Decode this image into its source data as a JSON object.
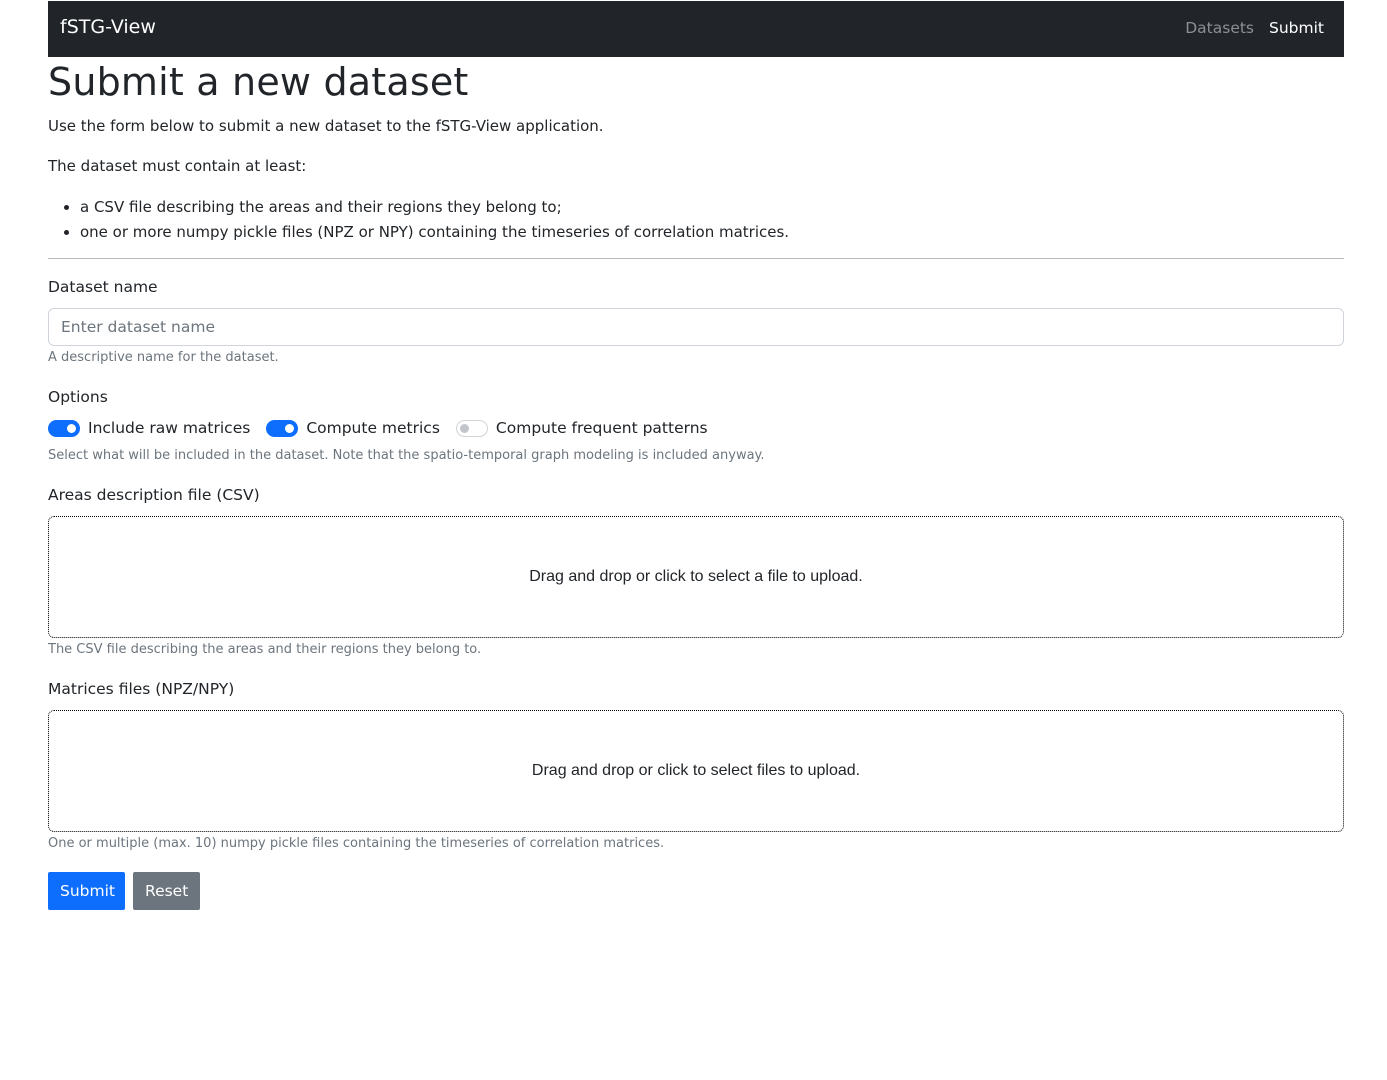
{
  "navbar": {
    "brand": "fSTG-View",
    "links": [
      {
        "label": "Datasets",
        "active": false
      },
      {
        "label": "Submit",
        "active": true
      }
    ]
  },
  "page": {
    "title": "Submit a new dataset",
    "intro": "Use the form below to submit a new dataset to the fSTG-View application.",
    "requirements_intro": "The dataset must contain at least:",
    "requirements": [
      "a CSV file describing the areas and their regions they belong to;",
      "one or more numpy pickle files (NPZ or NPY) containing the timeseries of correlation matrices."
    ]
  },
  "form": {
    "name": {
      "label": "Dataset name",
      "placeholder": "Enter dataset name",
      "value": "",
      "help": "A descriptive name for the dataset."
    },
    "options": {
      "label": "Options",
      "switches": [
        {
          "label": "Include raw matrices",
          "checked": true
        },
        {
          "label": "Compute metrics",
          "checked": true
        },
        {
          "label": "Compute frequent patterns",
          "checked": false
        }
      ],
      "help": "Select what will be included in the dataset. Note that the spatio-temporal graph modeling is included anyway."
    },
    "areas": {
      "label": "Areas description file (CSV)",
      "dropzone_text": "Drag and drop or click to select a file to upload.",
      "help": "The CSV file describing the areas and their regions they belong to."
    },
    "matrices": {
      "label": "Matrices files (NPZ/NPY)",
      "dropzone_text": "Drag and drop or click to select files to upload.",
      "help": "One or multiple (max. 10) numpy pickle files containing the timeseries of correlation matrices."
    },
    "submit_label": "Submit",
    "reset_label": "Reset"
  },
  "colors": {
    "navbar_bg": "#212529",
    "primary": "#0d6efd",
    "secondary": "#6c757d"
  }
}
